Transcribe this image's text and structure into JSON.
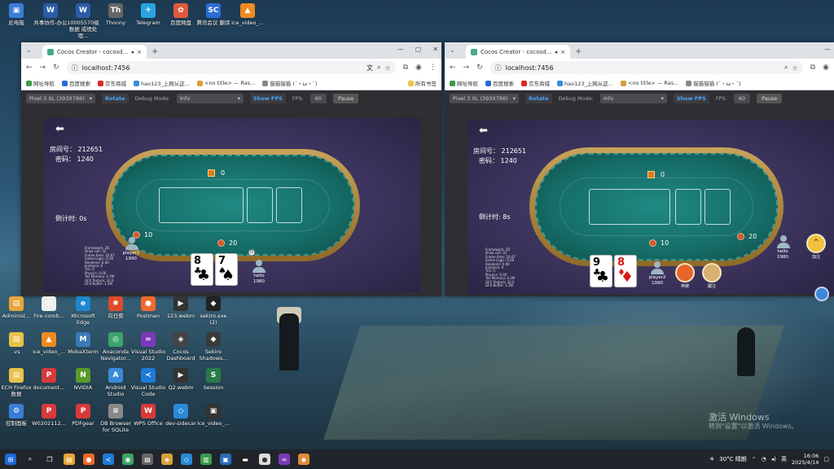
{
  "desktop": {
    "activate_title": "激活 Windows",
    "activate_sub": "转到\"设置\"以激活 Windows。",
    "icons_col1": [
      {
        "label": "此电脑",
        "color": "#3b7dd8",
        "glyph": "▣"
      },
      {
        "label": "Administ...",
        "color": "#e8a63a",
        "glyph": "▤"
      },
      {
        "label": ".vs",
        "color": "#e8c34a",
        "glyph": "▤"
      },
      {
        "label": "ECH Firefox 数据",
        "color": "#e8c34a",
        "glyph": "▤"
      },
      {
        "label": "控制面板",
        "color": "#3b7dd8",
        "glyph": "⚙"
      }
    ],
    "icons_top": [
      {
        "label": "共事协作-办公",
        "color": "#2b5ca8",
        "glyph": "W"
      },
      {
        "label": "10005570级 数据 成绩处理...",
        "color": "#2b5ca8",
        "glyph": "W"
      },
      {
        "label": "Thonny",
        "color": "#666",
        "glyph": "Th"
      },
      {
        "label": "Telegram",
        "color": "#2aa3e0",
        "glyph": "✈"
      },
      {
        "label": "百度网盘",
        "color": "#e0583a",
        "glyph": "✿"
      },
      {
        "label": "腾讯会议 翻译",
        "color": "#2a6cd8",
        "glyph": "SC"
      },
      {
        "label": "ice_video_...",
        "color": "#f08a20",
        "glyph": "▲"
      }
    ],
    "icons_grid": [
      {
        "label": "Fire comb...",
        "color": "#eee",
        "glyph": "▥"
      },
      {
        "label": "Microsoft Edge",
        "color": "#1e88d0",
        "glyph": "e"
      },
      {
        "label": "向日葵",
        "color": "#e04a2a",
        "glyph": "✺"
      },
      {
        "label": "Postman",
        "color": "#f06a2a",
        "glyph": "●"
      },
      {
        "label": "123.webm",
        "color": "#333",
        "glyph": "▶"
      },
      {
        "label": "sekiro.exe (2)",
        "color": "#222",
        "glyph": "◆"
      },
      {
        "label": "ice_video_...",
        "color": "#f08a20",
        "glyph": "▲"
      },
      {
        "label": "MobaXterm",
        "color": "#3a7ab8",
        "glyph": "M"
      },
      {
        "label": "Anaconda Navigator...",
        "color": "#3aa36a",
        "glyph": "◎"
      },
      {
        "label": "Visual Studio 2022",
        "color": "#7a3ab8",
        "glyph": "∞"
      },
      {
        "label": "Cocos Dashboard",
        "color": "#444",
        "glyph": "◈"
      },
      {
        "label": "Sekiro Shadows...",
        "color": "#3a3a3a",
        "glyph": "◆"
      },
      {
        "label": "document...",
        "color": "#d83a3a",
        "glyph": "P"
      },
      {
        "label": "NVIDIA",
        "color": "#5a9a2a",
        "glyph": "N"
      },
      {
        "label": "Android Studio",
        "color": "#3a8ad8",
        "glyph": "A"
      },
      {
        "label": "Visual Studio Code",
        "color": "#1e7ad8",
        "glyph": "≺"
      },
      {
        "label": "Q2.webm",
        "color": "#333",
        "glyph": "▶"
      },
      {
        "label": "Session",
        "color": "#2a7a4a",
        "glyph": "S"
      },
      {
        "label": "W0202112...",
        "color": "#d83a3a",
        "glyph": "P"
      },
      {
        "label": "PDFgear",
        "color": "#d83a3a",
        "glyph": "P"
      },
      {
        "label": "DB Browser for SQLite",
        "color": "#888",
        "glyph": "≡"
      },
      {
        "label": "WPS Office",
        "color": "#d83a3a",
        "glyph": "W"
      },
      {
        "label": "dev-sidecar",
        "color": "#2a8ad8",
        "glyph": "◇"
      },
      {
        "label": "ice_video_...",
        "color": "#333",
        "glyph": "▣"
      }
    ]
  },
  "window1": {
    "tab_title": "Cocos Creator - cocosd...",
    "url": "localhost:7456",
    "bookmarks": [
      "网址导航",
      "百度搜索",
      "京东商城",
      "hao123_上网从这...",
      "<no title> — Ras...",
      "猫猫猫猫 (´・ω・`)",
      "所有书签"
    ],
    "toolbar": {
      "device": "Pixel 3 XL (393X786)",
      "rotate": "Rotate",
      "debug_label": "Debug Mode:",
      "debug_value": "Info",
      "show_fps": "Show FPS",
      "fps_label": "FPS:",
      "fps_value": "60",
      "pause": "Pause"
    },
    "game": {
      "room_label": "房间号： 212651",
      "password_label": "密码： 1240",
      "countdown": "倒计时: 0s",
      "pot": "0",
      "bet_left": "10",
      "bet_center": "20",
      "player_left_name": "player2",
      "player_left_chips": "1990",
      "player_bottom_name": "hello",
      "player_bottom_chips": "1980",
      "cards": [
        {
          "rank": "8",
          "suit": "♣",
          "color": "#000"
        },
        {
          "rank": "7",
          "suit": "♠",
          "color": "#000"
        }
      ],
      "stats": "Framework: 2D\nDraw call: 32\nFrame time: 16.67\nGame Logic: 0.00\nRenderer: 0.00\nInstance: 0\nTris: 0\nPhysics: 0.00\nTex Memory: 4.2M\nGFX Texture: 32.0\nGFX Buffer: 1.3M"
    }
  },
  "window2": {
    "tab_title": "Cocos Creator - cocosd...",
    "url": "localhost:7456",
    "bookmarks": [
      "网址导航",
      "百度搜索",
      "京东商城",
      "hao123_上网从这...",
      "<no title> — Ras...",
      "猫猫猫猫 (´・ω・`)"
    ],
    "toolbar": {
      "device": "Pixel 3 XL (393X786)",
      "rotate": "Rotate",
      "debug_label": "Debug Mode:",
      "debug_value": "Info",
      "show_fps": "Show FPS",
      "fps_label": "FPS:",
      "fps_value": "60",
      "pause": "Pause"
    },
    "game": {
      "room_label": "房间号： 212651",
      "password_label": "密码： 1240",
      "countdown": "倒计时: 8s",
      "pot": "0",
      "bet_center": "10",
      "bet_right": "20",
      "player_right_name": "hello",
      "player_right_chips": "1980",
      "player_bottom_name": "player2",
      "player_bottom_chips": "1990",
      "cards": [
        {
          "rank": "9",
          "suit": "♣",
          "color": "#000"
        },
        {
          "rank": "8",
          "suit": "♦",
          "color": "#d81a1a"
        }
      ],
      "fold_label": "弃牌",
      "call_label": "跟注",
      "side_label": "加注",
      "stats": "Framework: 2D\nDraw call: 31\nFrame time: 16.67\nGame Logic: 0.00\nRenderer: 0.00\nInstance: 0\nTris: 0\nPhysics: 0.00\nTex Memory: 4.2M\nGFX Texture: 32.0\nGFX Buffer: 1.3M"
    }
  },
  "taskbar": {
    "weather": "30°C 晴朗",
    "lang": "英",
    "time": "16:06",
    "date": "2025/4/14"
  }
}
